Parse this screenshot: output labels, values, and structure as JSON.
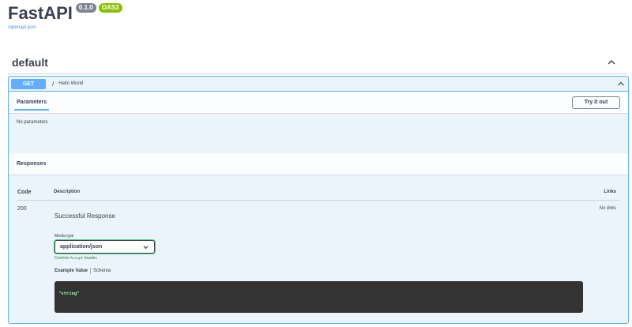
{
  "info": {
    "title": "FastAPI",
    "version": "0.1.0",
    "oas_badge": "OAS3",
    "spec_link": "/openapi.json"
  },
  "section": {
    "title": "default",
    "collapse_icon": "chevron-up-icon"
  },
  "operation": {
    "method": "GET",
    "path": "/",
    "summary": "Hello World",
    "collapse_icon": "chevron-up-icon"
  },
  "parameters": {
    "tab_label": "Parameters",
    "try_button": "Try it out",
    "empty_text": "No parameters"
  },
  "responses": {
    "title": "Responses",
    "columns": {
      "code": "Code",
      "description": "Description",
      "links": "Links"
    },
    "rows": [
      {
        "code": "200",
        "description": "Successful Response",
        "links": "No links",
        "media_type_label": "Media type",
        "media_type_value": "application/json",
        "controls_prefix": "Controls",
        "controls_code": "Accept",
        "controls_suffix": "header.",
        "example_tab": "Example Value",
        "schema_tab": "Schema",
        "example_code": "\"string\""
      }
    ]
  },
  "colors": {
    "get_blue": "#61affe",
    "op_background": "#ebf3fb",
    "version_badge": "#7d8492",
    "oas_badge": "#89bf04",
    "code_background": "#333333",
    "code_text": "#a2fca2"
  }
}
